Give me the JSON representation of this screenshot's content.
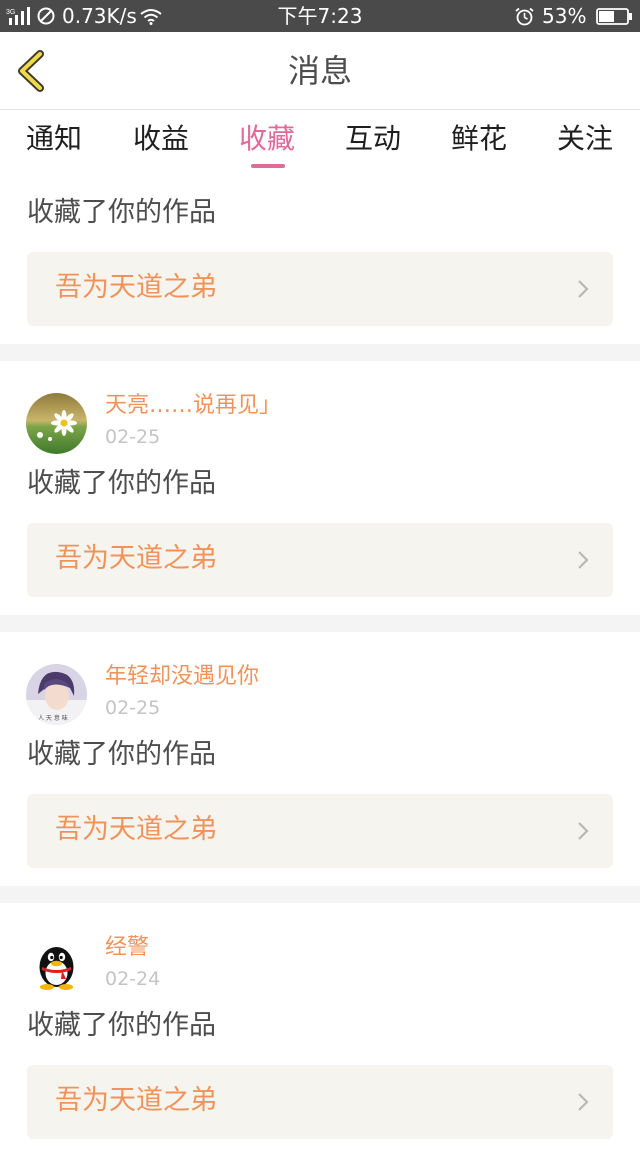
{
  "status_bar": {
    "network_type": "3G",
    "speed": "0.73K/s",
    "time": "下午7:23",
    "battery": "53%"
  },
  "header": {
    "title": "消息"
  },
  "tabs": [
    {
      "label": "通知",
      "active": false
    },
    {
      "label": "收益",
      "active": false
    },
    {
      "label": "收藏",
      "active": true
    },
    {
      "label": "互动",
      "active": false
    },
    {
      "label": "鲜花",
      "active": false
    },
    {
      "label": "关注",
      "active": false
    }
  ],
  "colors": {
    "accent": "#e06a9a",
    "username": "#f0935a",
    "work_box_bg": "#f5f4ef",
    "status_bar_bg": "#4a4a4a"
  },
  "messages": [
    {
      "user": "",
      "date": "",
      "avatar_icon": "",
      "action": "收藏了你的作品",
      "work": "吾为天道之弟"
    },
    {
      "user": "天亮……说再见」",
      "date": "02-25",
      "avatar_icon": "daisy-avatar",
      "action": "收藏了你的作品",
      "work": "吾为天道之弟"
    },
    {
      "user": "年轻却没遇见你",
      "date": "02-25",
      "avatar_icon": "portrait-avatar",
      "action": "收藏了你的作品",
      "work": "吾为天道之弟"
    },
    {
      "user": "经警",
      "date": "02-24",
      "avatar_icon": "qq-penguin-avatar",
      "action": "收藏了你的作品",
      "work": "吾为天道之弟"
    }
  ]
}
